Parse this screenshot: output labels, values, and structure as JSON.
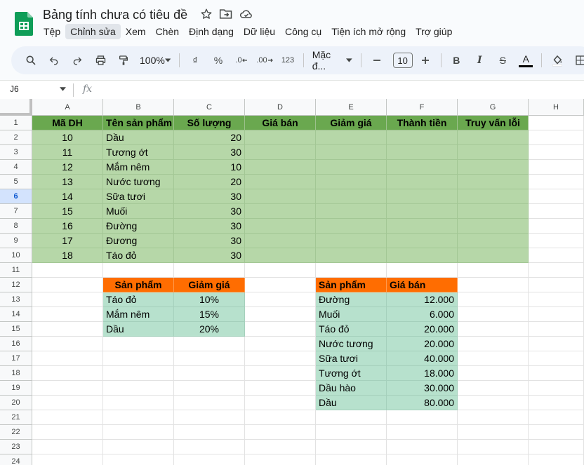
{
  "app": {
    "doc_title": "Bảng tính chưa có tiêu đề",
    "menu": [
      "Tệp",
      "Chỉnh sửa",
      "Xem",
      "Chèn",
      "Định dạng",
      "Dữ liệu",
      "Công cụ",
      "Tiện ích mở rộng",
      "Trợ giúp"
    ],
    "active_menu_index": 1
  },
  "toolbar": {
    "zoom": "100%",
    "currency": "₫",
    "percent": "%",
    "dec_decrease": ".0",
    "dec_increase": ".00",
    "number_format": "123",
    "font": "Mặc đ...",
    "font_size": "10",
    "bold": "B",
    "italic": "I",
    "strike": "S",
    "text_color": "A"
  },
  "formula_bar": {
    "cell_ref": "J6",
    "fx_label": "fx",
    "formula": ""
  },
  "grid": {
    "column_headers": [
      "A",
      "B",
      "C",
      "D",
      "E",
      "F",
      "G",
      "H"
    ],
    "row_numbers": [
      "1",
      "2",
      "3",
      "4",
      "5",
      "6",
      "7",
      "8",
      "9",
      "10",
      "11",
      "12",
      "13",
      "14",
      "15",
      "16",
      "17",
      "18",
      "19",
      "20",
      "21",
      "22",
      "23",
      "24"
    ],
    "selected_row": "6",
    "table_main": {
      "headers": [
        "Mã DH",
        "Tên sản phẩm",
        "Số lượng",
        "Giá bán",
        "Giảm giá",
        "Thành tiền",
        "Truy vấn lỗi"
      ],
      "rows": [
        [
          "10",
          "Dầu",
          "20"
        ],
        [
          "11",
          "Tương ớt",
          "30"
        ],
        [
          "12",
          "Mắm nêm",
          "10"
        ],
        [
          "13",
          "Nước tương",
          "20"
        ],
        [
          "14",
          "Sữa tươi",
          "30"
        ],
        [
          "15",
          "Muối",
          "30"
        ],
        [
          "16",
          "Đường",
          "30"
        ],
        [
          "17",
          "Đương",
          "30"
        ],
        [
          "18",
          "Táo đỏ",
          "30"
        ]
      ]
    },
    "table_discount": {
      "headers": [
        "Sản phẩm",
        "Giảm giá"
      ],
      "rows": [
        [
          "Táo đỏ",
          "10%"
        ],
        [
          "Mắm nêm",
          "15%"
        ],
        [
          "Dầu",
          "20%"
        ]
      ]
    },
    "table_price": {
      "headers": [
        "Sản phẩm",
        "Giá bán"
      ],
      "rows": [
        [
          "Đường",
          "12.000"
        ],
        [
          "Muối",
          "6.000"
        ],
        [
          "Táo đỏ",
          "20.000"
        ],
        [
          "Nước tương",
          "20.000"
        ],
        [
          "Sữa tươi",
          "40.000"
        ],
        [
          "Tương ớt",
          "18.000"
        ],
        [
          "Dầu hào",
          "30.000"
        ],
        [
          "Dầu",
          "80.000"
        ]
      ]
    }
  },
  "colors": {
    "header_green": "#6aa84f",
    "data_green": "#b6d7a8",
    "header_orange": "#ff6d01",
    "data_mint": "#b7e1cd"
  }
}
